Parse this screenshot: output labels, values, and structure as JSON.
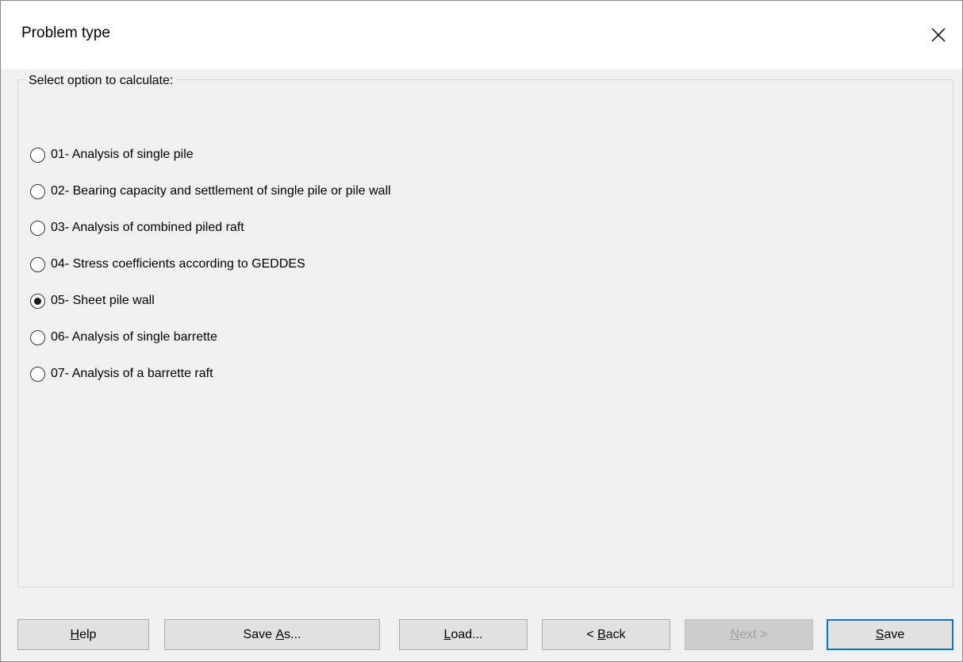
{
  "window": {
    "title": "Problem type"
  },
  "group": {
    "legend": "Select option to calculate:"
  },
  "options": [
    {
      "label": "01- Analysis of single pile",
      "selected": false
    },
    {
      "label": "02- Bearing capacity and settlement of single pile or pile wall",
      "selected": false
    },
    {
      "label": "03- Analysis of combined piled raft",
      "selected": false
    },
    {
      "label": "04- Stress coefficients according to GEDDES",
      "selected": false
    },
    {
      "label": "05- Sheet pile wall",
      "selected": true
    },
    {
      "label": "06- Analysis of single barrette",
      "selected": false
    },
    {
      "label": "07- Analysis of a barrette raft",
      "selected": false
    }
  ],
  "buttons": {
    "help": {
      "mn": "H",
      "rest": "elp"
    },
    "save_as": {
      "pre": "Save ",
      "mn": "A",
      "rest": "s..."
    },
    "load": {
      "mn": "L",
      "rest": "oad..."
    },
    "back": {
      "pre": "< ",
      "mn": "B",
      "rest": "ack"
    },
    "next": {
      "mn": "N",
      "rest": "ext >",
      "disabled": true
    },
    "save": {
      "mn": "S",
      "rest": "ave"
    }
  },
  "icons": {
    "close": "close-icon"
  },
  "colors": {
    "accent": "#0078d7",
    "background": "#f0f0f0",
    "titlebar": "#ffffff"
  }
}
